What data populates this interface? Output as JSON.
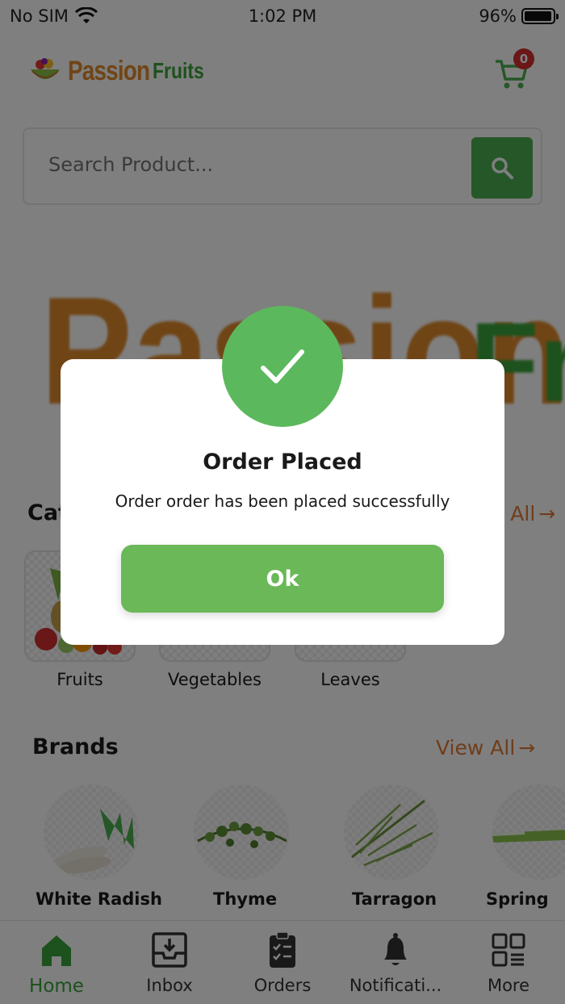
{
  "status_bar": {
    "carrier": "No SIM",
    "time": "1:02 PM",
    "battery_percent_label": "96%",
    "battery_level": 0.96
  },
  "header": {
    "logo_word_1": "Passion",
    "logo_word_2": "Fruits",
    "cart_count": "0"
  },
  "search": {
    "placeholder": "Search Product..."
  },
  "banner": {
    "text_1": "Passion",
    "text_2": "Fr"
  },
  "categories": {
    "title": "Categories",
    "view_all": "View All",
    "items": [
      {
        "label": "Fruits"
      },
      {
        "label": "Vegetables"
      },
      {
        "label": "Leaves"
      }
    ]
  },
  "brands": {
    "title": "Brands",
    "view_all": "View All",
    "items": [
      {
        "label": "White Radish"
      },
      {
        "label": "Thyme"
      },
      {
        "label": "Tarragon"
      },
      {
        "label": "Spring"
      }
    ]
  },
  "tabbar": {
    "items": [
      {
        "label": "Home",
        "icon": "home-icon",
        "active": true
      },
      {
        "label": "Inbox",
        "icon": "inbox-icon"
      },
      {
        "label": "Orders",
        "icon": "clipboard-icon"
      },
      {
        "label": "Notificati...",
        "icon": "bell-icon"
      },
      {
        "label": "More",
        "icon": "grid-icon"
      }
    ]
  },
  "modal": {
    "title": "Order Placed",
    "message": "Order order has been placed successfully",
    "ok_label": "Ok",
    "icon": "checkmark-icon"
  },
  "colors": {
    "primary_green": "#4caf50",
    "accent_orange": "#e07a35",
    "badge_red": "#d32f2f"
  }
}
